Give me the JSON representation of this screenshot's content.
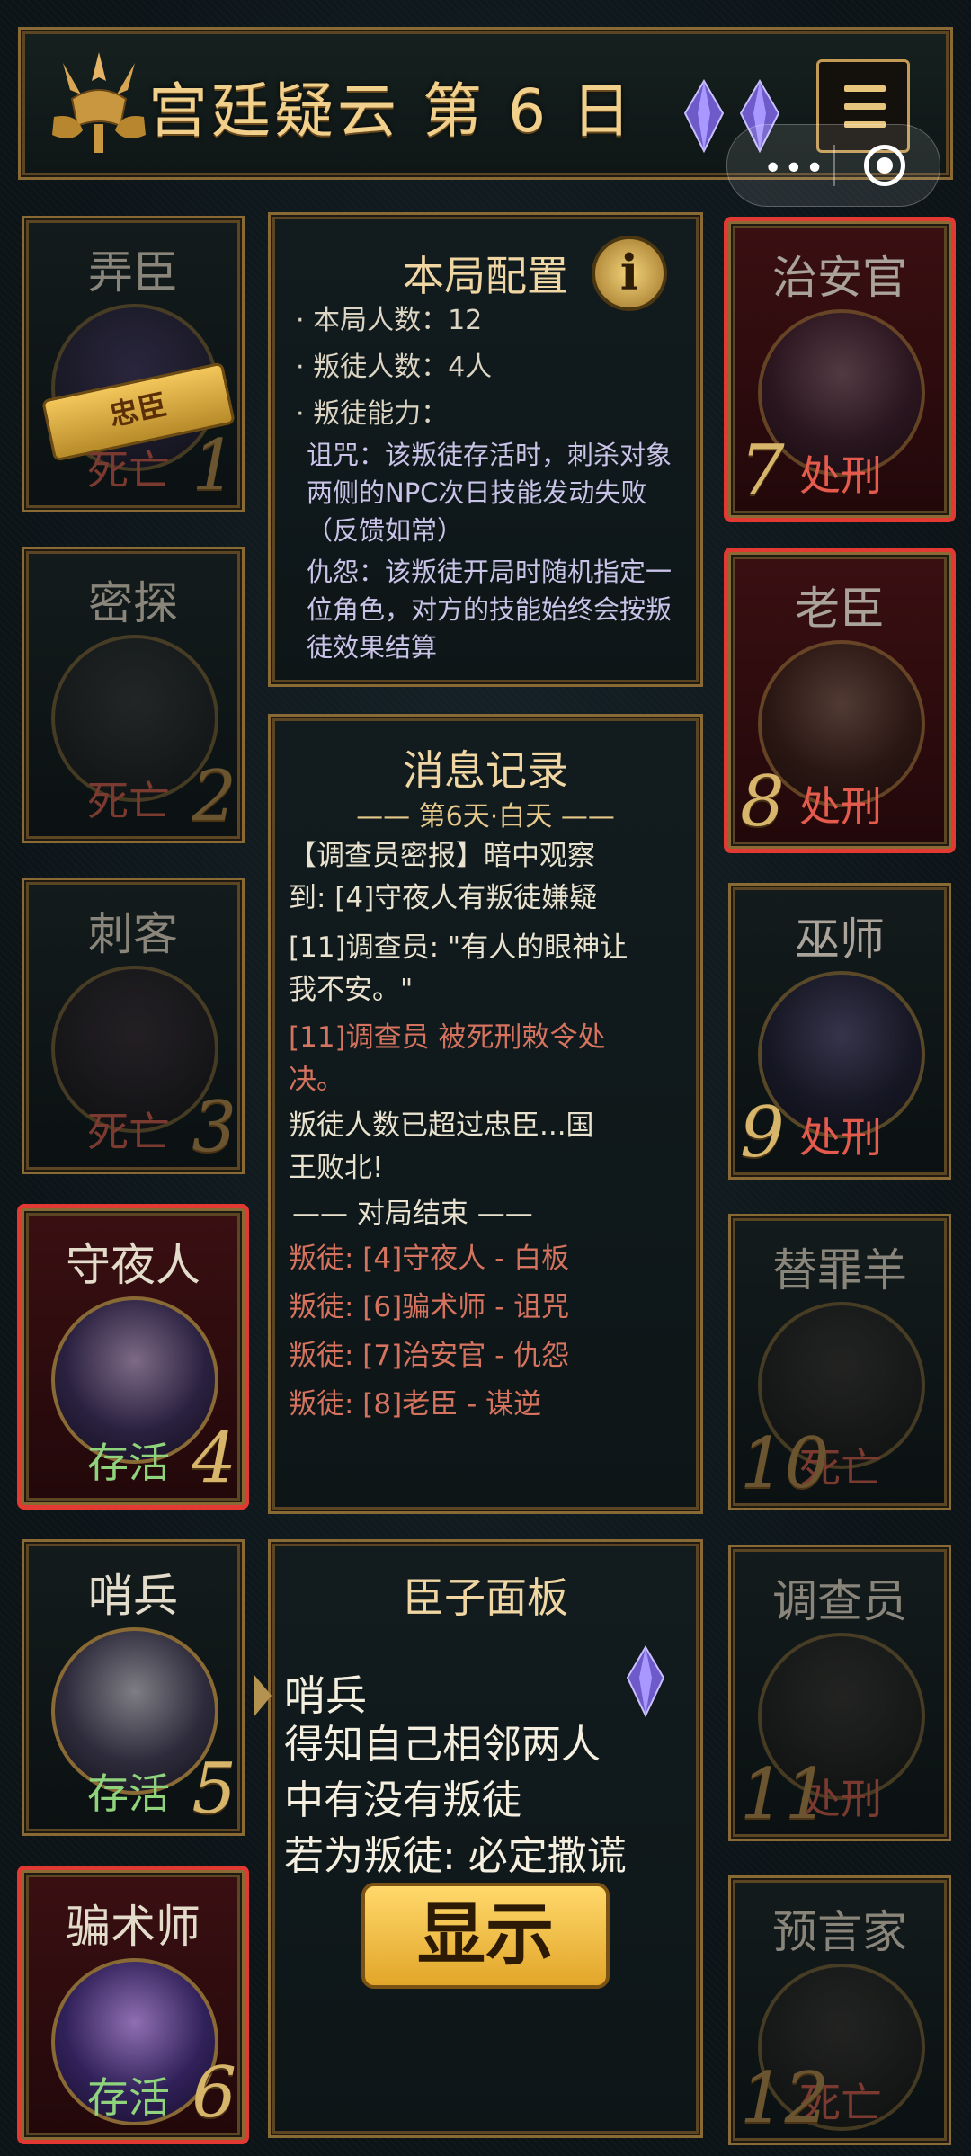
{
  "header": {
    "title": "宫廷疑云 第 6 日",
    "gems": [
      "purple-gem-icon",
      "purple-gem-icon"
    ],
    "menu_icon": "menu-icon"
  },
  "system_capsule": {
    "dots": "•••",
    "target_icon": "target-icon"
  },
  "players_left": [
    {
      "name": "弄臣",
      "status": "死亡",
      "num": "1",
      "tag": "忠臣",
      "highlight": false
    },
    {
      "name": "密探",
      "status": "死亡",
      "num": "2",
      "highlight": false
    },
    {
      "name": "刺客",
      "status": "死亡",
      "num": "3",
      "highlight": false
    },
    {
      "name": "守夜人",
      "status": "存活",
      "num": "4",
      "highlight": true
    },
    {
      "name": "哨兵",
      "status": "存活",
      "num": "5",
      "highlight": false
    },
    {
      "name": "骗术师",
      "status": "存活",
      "num": "6",
      "highlight": true
    }
  ],
  "players_right": [
    {
      "name": "治安官",
      "status": "处刑",
      "num": "7",
      "highlight": true
    },
    {
      "name": "老臣",
      "status": "处刑",
      "num": "8",
      "highlight": true
    },
    {
      "name": "巫师",
      "status": "处刑",
      "num": "9",
      "highlight": false
    },
    {
      "name": "替罪羊",
      "status": "死亡",
      "num": "10",
      "highlight": false
    },
    {
      "name": "调查员",
      "status": "处刑",
      "num": "11",
      "highlight": false
    },
    {
      "name": "预言家",
      "status": "死亡",
      "num": "12",
      "highlight": false
    }
  ],
  "config": {
    "title": "本局配置",
    "players_line": "· 本局人数：12",
    "traitors_line": "· 叛徒人数：4人",
    "abilities_line": "· 叛徒能力：",
    "curse": "诅咒：该叛徒存活时，刺杀对象两侧的NPC次日技能发动失败（反馈如常）",
    "grudge": "仇怨：该叛徒开局时随机指定一位角色，对方的技能始终会按叛徒效果结算"
  },
  "log": {
    "title": "消息记录",
    "day_header": "—— 第6天·白天 ——",
    "l1": "【调查员密报】暗中观察",
    "l2": "到: [4]守夜人有叛徒嫌疑",
    "l3": "[11]调查员: \"有人的眼神让",
    "l4": "我不安。\"",
    "l5": "[11]调查员 被死刑敕令处",
    "l6": "决。",
    "l7": "叛徒人数已超过忠臣...国",
    "l8": "王败北!",
    "end_header": "—— 对局结束 ——",
    "t1": "叛徒: [4]守夜人 - 白板",
    "t2": "叛徒: [6]骗术师 - 诅咒",
    "t3": "叛徒: [7]治安官 - 仇怨",
    "t4": "叛徒: [8]老臣 - 谋逆"
  },
  "minister": {
    "title": "臣子面板",
    "role": "哨兵",
    "d1": "得知自己相邻两人",
    "d2": "中有没有叛徒",
    "d3": "若为叛徒: 必定撒谎",
    "button": "显示"
  },
  "colors": {
    "gold": "#e6c277",
    "highlight": "#e23a33",
    "dead": "#e45a4c",
    "alive": "#8fd37d"
  }
}
